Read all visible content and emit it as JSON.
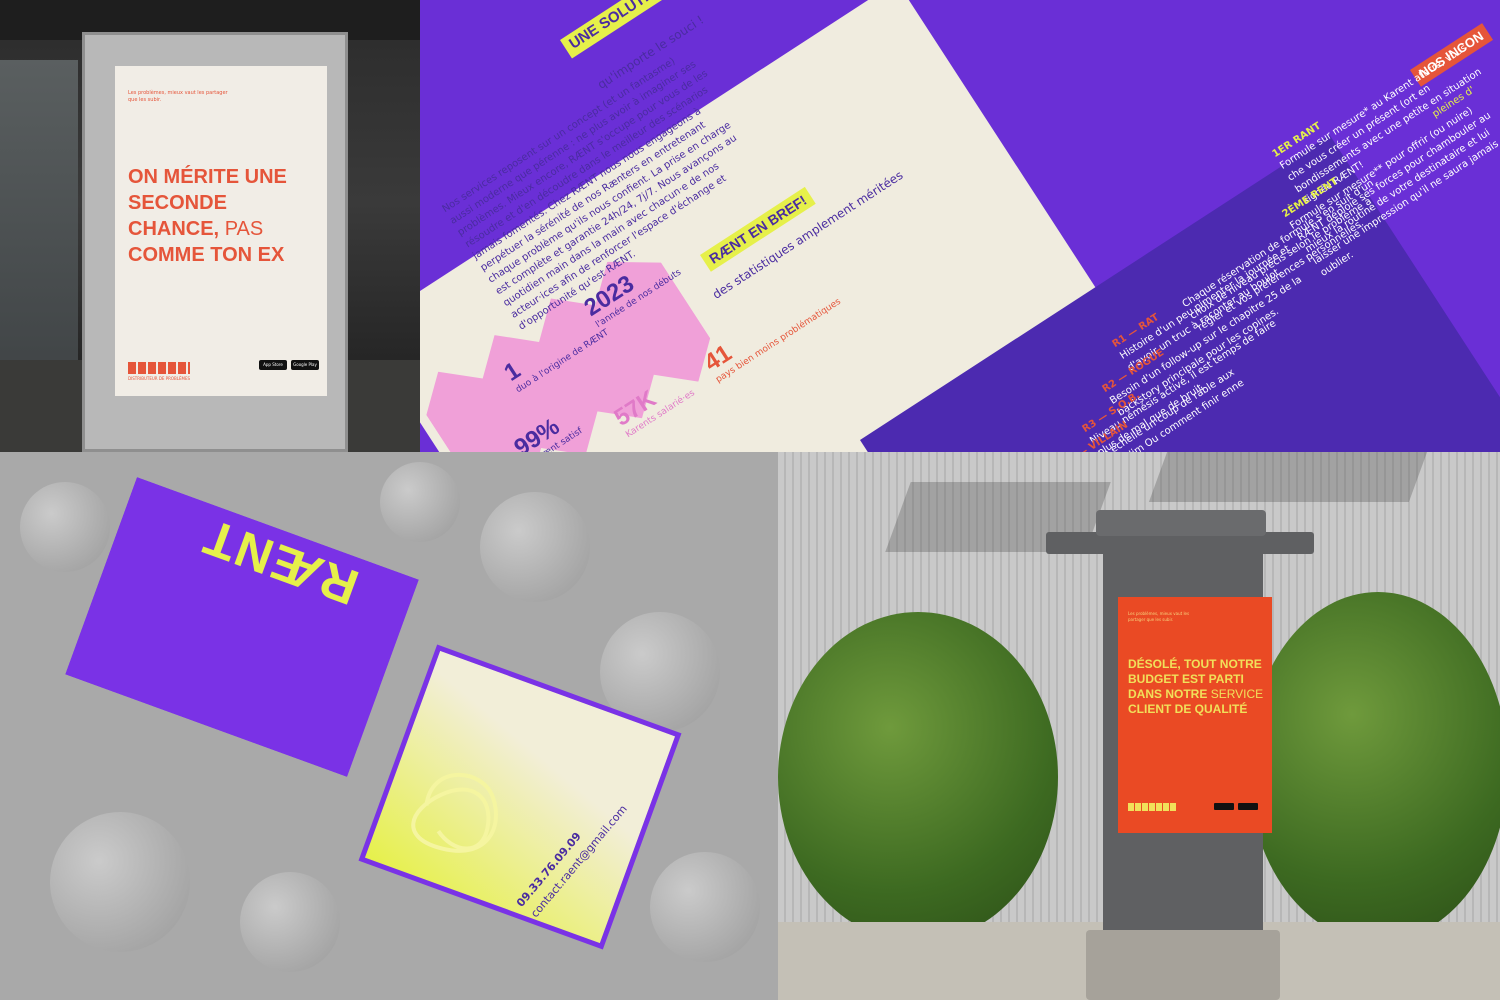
{
  "bus_poster": {
    "tagline": "Les problèmes, mieux vaut les partager que les subir.",
    "headline_bold_1": "ON MÉRITE UNE SECONDE CHANCE,",
    "headline_thin": "PAS",
    "headline_bold_2": "COMME TON EX",
    "brand_caption": "DISTRIBUTEUR DE PROBLÈMES",
    "store_1": "App Store",
    "store_2": "Google Play"
  },
  "flyer": {
    "title": "UNE SOLUTION POUR TOUS·TES…",
    "subtitle": "qu'importe le souci !",
    "body": "Nos services reposent sur un concept (et un fantasme) aussi moderne que pérenne : ne plus avoir à imaginer ses problèmes. Mieux encore, RÆNT s'occupe pour vous de les résoudre et d'en découdre dans le meilleur des scénarios jamais fomentés. Chez RÆNT nous nous engageons à perpétuer la sérénité de nos Rænters en entretenant chaque problème qu'ils nous confient. La prise en charge est complète et garantie 24h/24, 7j/7. Nous avançons au quotidien main dans la main avec chacun·e de nos acteur·ices afin de renforcer l'espace d'échange et d'opportunité qu'est RÆNT.",
    "bref_title": "RÆNT EN BREF!",
    "bref_sub": "des statistiques amplement méritées",
    "stats": [
      {
        "num": "2023",
        "cap": "l'année de nos débuts"
      },
      {
        "num": "41",
        "cap": "pays bien moins problématiques"
      },
      {
        "num": "1",
        "cap": "duo à l'origine de RÆNT"
      },
      {
        "num": "57K",
        "cap": "Karents salarié·es"
      },
      {
        "num": "99%",
        "cap": "de Rænt satisf"
      }
    ],
    "right_title": "NOS INCON",
    "right_sub": "pleines d'",
    "rant_1_title": "1ER RANT",
    "rant_1_body": "Formule sur mesure* au Karent attitré, vous che vous créer un présent (ort en bondissements avec une petite en situation signée RÆNT!",
    "rant_2_title": "2ÈME RENT",
    "rant_2_body": "Formule sur mesure** pour offrir (ou nuire) RÆNT déploie ses forces pour chambouler au mieux la routine de votre destinataire et lui laisser une impression qu'il ne saura jamais oublier.",
    "levels_intro": "Chaque réservation de formule s'en suit d'un choix de niveau précis selon le problème à régler et vos préférences personnelles.",
    "levels": [
      {
        "code": "R1 — RAT",
        "text": "Histoire d'un peu pimenter la journée et d'avoir un truc à raconter au boulot."
      },
      {
        "code": "R2 — ROGUE",
        "text": "Besoin d'un follow-up sur le chapitre 25 de la backstory principale pour les copines."
      },
      {
        "code": "R3 — S.O.B.",
        "text": "Niveau némésis activé, il est temps de faire plus de mal que de bruit."
      },
      {
        "code": "R4 — VILLAIN",
        "text": "À grande échelle un coup de rable aux dépens de n'im Ou comment finir enne"
      }
    ]
  },
  "cards": {
    "logo": "RÆNT",
    "phone": "09.33.76.09.09",
    "email": "contact.raent@gmail.com"
  },
  "column_poster": {
    "tagline": "Les problèmes, mieux vaut les partager que les subir.",
    "headline_1": "DÉSOLÉ, TOUT NOTRE BUDGET EST PARTI DANS NOTRE",
    "headline_thin": "SERVICE",
    "headline_2": "CLIENT DE QUALITÉ"
  },
  "colors": {
    "purple": "#6a2fd6",
    "orange": "#e5553a",
    "yellow": "#e6f04a",
    "pink": "#f0a0d8",
    "cream": "#f0ecdf"
  }
}
